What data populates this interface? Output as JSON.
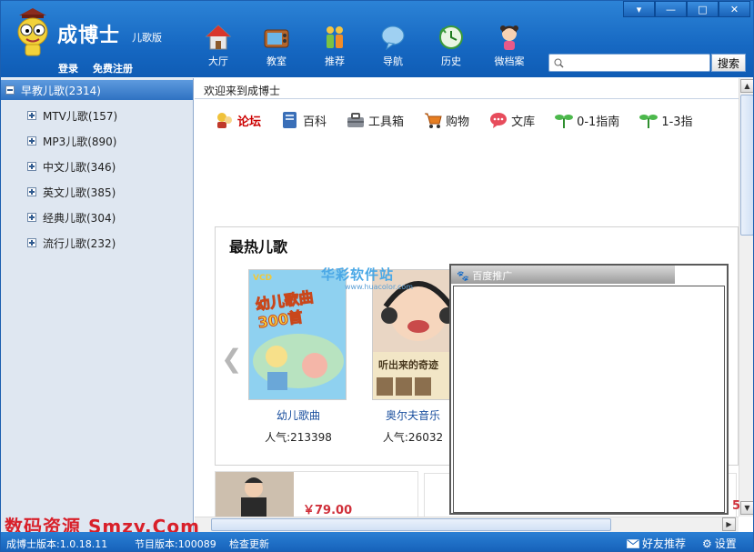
{
  "app": {
    "logo_title": "成博士",
    "logo_sub": "儿歌版",
    "login": "登录",
    "register": "免费注册"
  },
  "nav": [
    {
      "label": "大厅",
      "icon": "house-icon"
    },
    {
      "label": "教室",
      "icon": "tv-icon"
    },
    {
      "label": "推荐",
      "icon": "people-icon"
    },
    {
      "label": "导航",
      "icon": "chat-bubble-icon"
    },
    {
      "label": "历史",
      "icon": "history-icon"
    },
    {
      "label": "微档案",
      "icon": "girl-avatar-icon"
    }
  ],
  "window_controls": [
    "▾",
    "—",
    "□",
    "✕"
  ],
  "search": {
    "placeholder": "",
    "button": "搜索"
  },
  "sidebar": {
    "root": "早教儿歌(2314)",
    "items": [
      {
        "label": "MTV儿歌(157)"
      },
      {
        "label": "MP3儿歌(890)"
      },
      {
        "label": "中文儿歌(346)"
      },
      {
        "label": "英文儿歌(385)"
      },
      {
        "label": "经典儿歌(304)"
      },
      {
        "label": "流行儿歌(232)"
      }
    ]
  },
  "content": {
    "welcome": "欢迎来到成博士",
    "links": [
      {
        "label": "论坛",
        "icon": "forum-icon"
      },
      {
        "label": "百科",
        "icon": "book-icon"
      },
      {
        "label": "工具箱",
        "icon": "toolbox-icon"
      },
      {
        "label": "购物",
        "icon": "cart-icon"
      },
      {
        "label": "文库",
        "icon": "chat-icon"
      },
      {
        "label": "0-1指南",
        "icon": "sprout-icon"
      },
      {
        "label": "1-3指",
        "icon": "sprout-icon"
      }
    ],
    "hot_title": "最热儿歌",
    "prev": "❮",
    "songs": [
      {
        "title": "幼儿歌曲",
        "popularity": "人气:213398",
        "cover_text": "幼儿歌曲300首",
        "cover_tag": "VCD"
      },
      {
        "title": "奥尔夫音乐",
        "popularity": "人气:26032",
        "cover_text": "听出来的奇迹"
      }
    ],
    "price": "￥79.00"
  },
  "ad": {
    "header": "百度推广"
  },
  "watermarks": {
    "center": "华彩软件站",
    "center_sub": "www.huacolor.com",
    "bottom_left": "数码资源 Smzy.Com"
  },
  "status": {
    "version": "成博士版本:1.0.18.11",
    "program_version": "节目版本:100089",
    "update": "检查更新",
    "share": "好友推荐",
    "settings": "设置",
    "right_edge": "5"
  },
  "colors": {
    "header": "#1668c2",
    "sidebar": "#dfe7f1",
    "price": "#d0303a",
    "link": "#1a4f9e"
  }
}
